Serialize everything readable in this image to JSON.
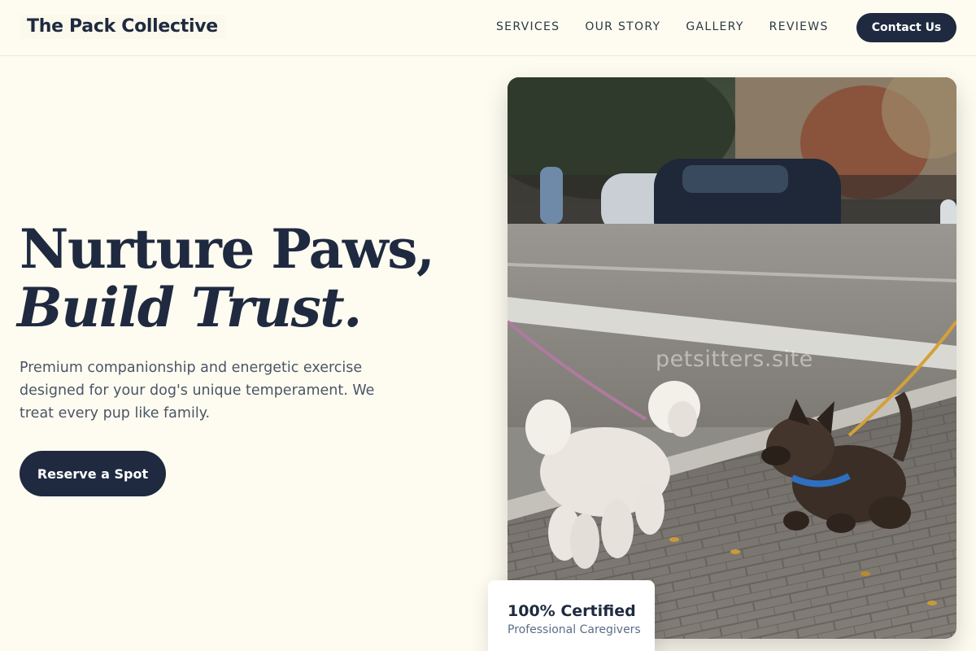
{
  "header": {
    "logo": "The Pack Collective",
    "nav": [
      "SERVICES",
      "OUR STORY",
      "GALLERY",
      "REVIEWS"
    ],
    "contact_label": "Contact Us"
  },
  "hero": {
    "title_line1": "Nurture Paws,",
    "title_line2": "Build Trust.",
    "subtitle": "Premium companionship and energetic exercise designed for your dog's unique temperament. We treat every pup like family.",
    "cta_label": "Reserve a Spot"
  },
  "photo": {
    "watermark": "petsitters.site"
  },
  "badge": {
    "title": "100% Certified",
    "subtitle": "Professional Caregivers"
  },
  "colors": {
    "background": "#fefcf0",
    "primary": "#1f2a40",
    "text_muted": "#4a5568"
  }
}
